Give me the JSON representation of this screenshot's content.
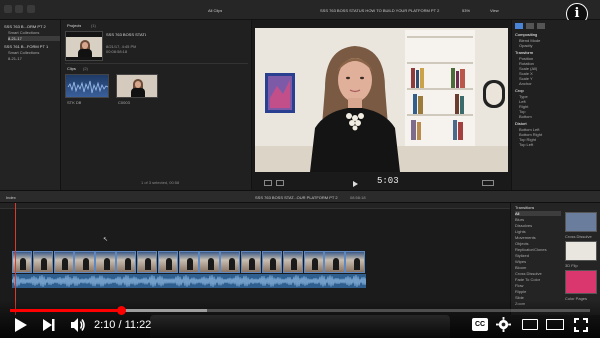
{
  "app": {
    "window": "YouTube video player",
    "subject": "Final Cut Pro editing screenshot"
  },
  "topbar": {
    "left_menu": "All Clips",
    "center_title": "SSS 763 BOSS STATUS HOW TO BUILD YOUR PLATFORM PT 2",
    "view_label": "View",
    "zoom": "53%",
    "info_icon": "i"
  },
  "library": {
    "items": [
      {
        "label": "SSS 763 B...ORM PT 2"
      },
      {
        "label": "Smart Collections"
      },
      {
        "label": "8-21-17"
      },
      {
        "label": "SSS 761 B...FORM PT 1"
      },
      {
        "label": "Smart Collections"
      },
      {
        "label": "8-21-17"
      }
    ]
  },
  "browser": {
    "projects_title": "Projects",
    "projects_count": "(1)",
    "project": {
      "name": "SSS 763 BOSS STATUS...RM PT 2",
      "date": "8/21/17, 4:45 PM",
      "duration": "00:08:58:18"
    },
    "clips_title": "Clips",
    "clips_count": "(2)",
    "clip1_label": "STK DB",
    "clip2_label": "C0003",
    "footer": "1 of 3 selected, 00:58"
  },
  "viewer": {
    "timecode": "5:03"
  },
  "inspector": {
    "sections": [
      {
        "title": "Compositing",
        "rows": [
          "Blend Mode",
          "Opacity"
        ]
      },
      {
        "title": "Transform",
        "rows": [
          "Position",
          "Rotation",
          "Scale (All)",
          "Scale X",
          "Scale Y",
          "Anchor"
        ]
      },
      {
        "title": "Crop",
        "rows": [
          "Type",
          "Left",
          "Right",
          "Top",
          "Bottom"
        ]
      },
      {
        "title": "Distort",
        "rows": [
          "Bottom Left",
          "Bottom Right",
          "Top Right",
          "Top Left"
        ]
      }
    ]
  },
  "timeline_bar": {
    "index_label": "Index",
    "project_label": "SSS 763 BOSS STAT...OUR PLATFORM PT 2",
    "duration": "08:58:18"
  },
  "timeline": {
    "clip_count": 17,
    "audio_wave": "yes",
    "playhead_color": "#d63b2b"
  },
  "effects": {
    "header": "Transitions",
    "items": [
      "All",
      "Blurs",
      "Dissolves",
      "Lights",
      "Movements",
      "Objects",
      "Replicator/Clones",
      "Stylized",
      "Wipes",
      "Bloom",
      "Cross Dissolve",
      "Fade To Color",
      "Flow",
      "Ripple",
      "Slide",
      "Zoom"
    ],
    "thumb_labels": [
      "Cross Dissolve",
      "3D Flip",
      "Color Pages"
    ]
  },
  "player": {
    "current_time": "2:10",
    "duration": "11:22",
    "time_separator": " / ",
    "progress_fraction": 0.191,
    "buffered_fraction": 0.34,
    "accent": "#ff0000"
  },
  "dock": {
    "icons": [
      "app"
    ]
  }
}
